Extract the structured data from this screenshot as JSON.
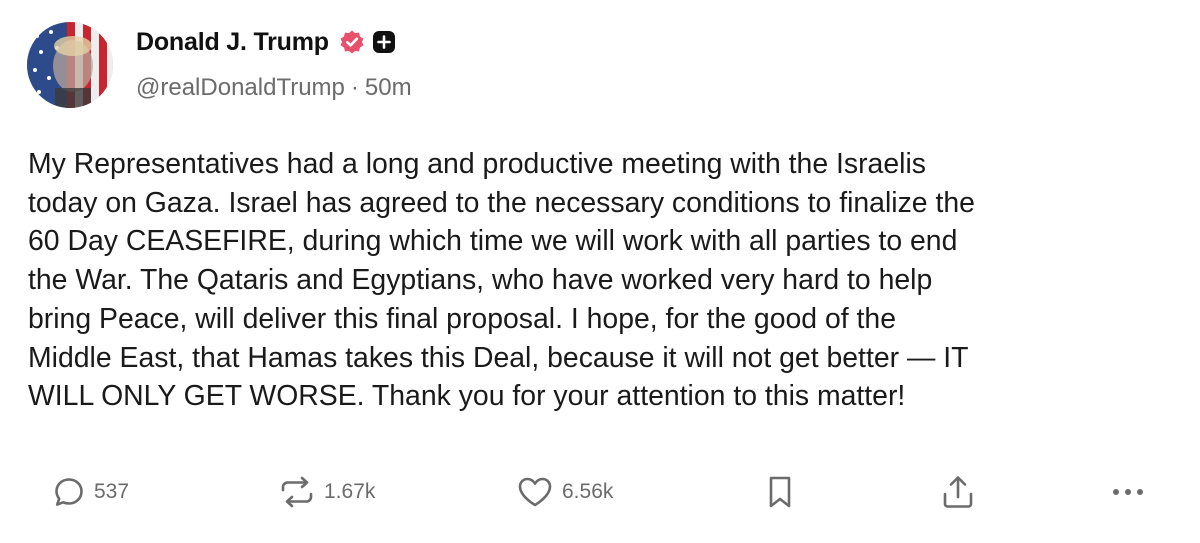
{
  "author": {
    "display_name": "Donald J. Trump",
    "handle": "@realDonaldTrump",
    "separator": "·",
    "time_ago": "50m",
    "verified_color": "#e8506c",
    "avatar_icon": "flag-portrait-avatar"
  },
  "post": {
    "lines": [
      "My Representatives had a long and productive meeting with the Israelis",
      "today on Gaza. Israel has agreed to the necessary conditions to finalize the",
      "60 Day CEASEFIRE, during which time we will work with all parties to end",
      "the War. The Qataris and Egyptians, who have worked very hard to help",
      "bring Peace, will deliver this final proposal. I hope, for the good of the",
      "Middle East, that Hamas takes this Deal, because it will not get better — IT",
      "WILL ONLY GET WORSE. Thank you for your attention to this matter!"
    ]
  },
  "actions": {
    "reply": {
      "icon": "reply-bubble-icon",
      "count": "537"
    },
    "repost": {
      "icon": "repost-arrows-icon",
      "count": "1.67k"
    },
    "like": {
      "icon": "heart-icon",
      "count": "6.56k"
    },
    "bookmark": {
      "icon": "bookmark-icon"
    },
    "share": {
      "icon": "share-upload-icon"
    },
    "more": {
      "icon": "more-dots-icon"
    }
  }
}
